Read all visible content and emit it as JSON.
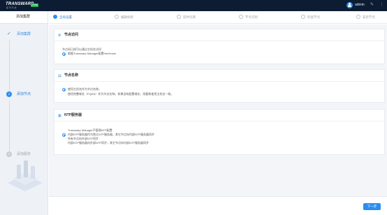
{
  "header": {
    "logo_text": "TRANSWARP",
    "logo_sub": "星 环 科 技",
    "logo_badge": "CORE",
    "user": "admin",
    "icons": [
      "user-avatar",
      "settings-icon",
      "menu-icon"
    ]
  },
  "sidebar": {
    "title": "添加集群",
    "steps": [
      {
        "label": "添加集群",
        "state": "done"
      },
      {
        "label": "添加节点",
        "number": "2",
        "state": "active"
      },
      {
        "label": "添加服务",
        "number": "3",
        "state": "todo"
      }
    ]
  },
  "tabs": [
    {
      "label": "全局设置",
      "active": true
    },
    {
      "label": "编辑机柜",
      "active": false
    },
    {
      "label": "软件包库",
      "active": false
    },
    {
      "label": "节点识别",
      "active": false
    },
    {
      "label": "检查节点",
      "active": false
    },
    {
      "label": "安装节点",
      "active": false
    }
  ],
  "sections": {
    "access": {
      "title": "节点访问",
      "options": [
        {
          "text": "节点间已经可以通过主机名访问",
          "selected": false
        },
        {
          "text": "根据Transwarp Manager配置/etc/hosts",
          "selected": true
        }
      ]
    },
    "hostname": {
      "title": "节点名称",
      "options": [
        {
          "text": "使用主机名作为节点名称。",
          "selected": true
        }
      ],
      "note": "使用完整域名（FQDN）作为节点名称。如果没有配置域名，则要和使用主机名一致。"
    },
    "ntp": {
      "title": "NTP服务器",
      "options": [
        {
          "text": "Transwarp Manager不管理NTP配置",
          "selected": false
        },
        {
          "text": "内部NTP服务器作为独立NTP服务器，其它节点向内部NTP服务器同步",
          "selected": true
        },
        {
          "text": "所有节点向外部NTP同步",
          "selected": false
        },
        {
          "text": "内部NTP服务器向外部NTP同步，其它节点向内部NTP服务器同步",
          "selected": false
        }
      ]
    }
  },
  "footer": {
    "next_label": "下一步"
  },
  "colors": {
    "topbar": "#0c1d33",
    "accent": "#2b8ef0",
    "sidebar_bg": "#eef1f6",
    "main_bg": "#f3f5f8"
  }
}
